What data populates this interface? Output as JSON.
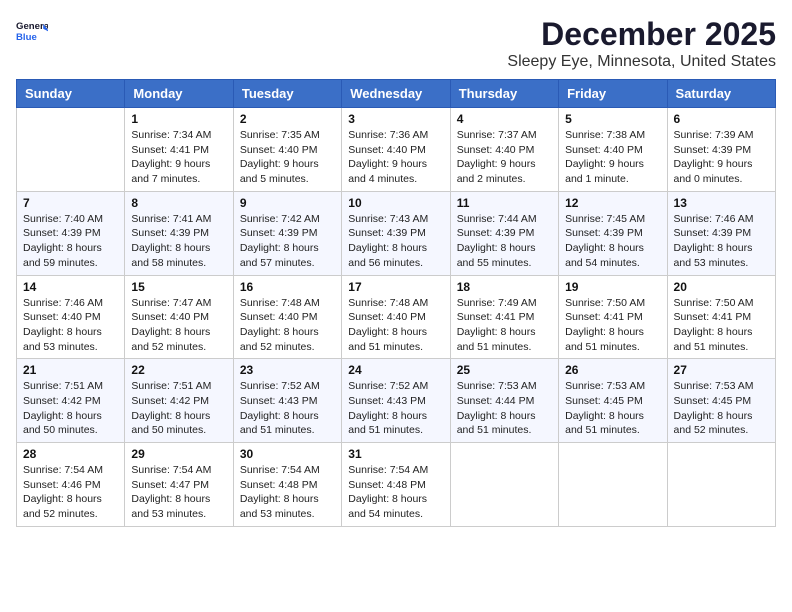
{
  "logo": {
    "general": "General",
    "blue": "Blue"
  },
  "header": {
    "title": "December 2025",
    "subtitle": "Sleepy Eye, Minnesota, United States"
  },
  "weekdays": [
    "Sunday",
    "Monday",
    "Tuesday",
    "Wednesday",
    "Thursday",
    "Friday",
    "Saturday"
  ],
  "weeks": [
    [
      {
        "day": "",
        "sunrise": "",
        "sunset": "",
        "daylight": ""
      },
      {
        "day": "1",
        "sunrise": "Sunrise: 7:34 AM",
        "sunset": "Sunset: 4:41 PM",
        "daylight": "Daylight: 9 hours and 7 minutes."
      },
      {
        "day": "2",
        "sunrise": "Sunrise: 7:35 AM",
        "sunset": "Sunset: 4:40 PM",
        "daylight": "Daylight: 9 hours and 5 minutes."
      },
      {
        "day": "3",
        "sunrise": "Sunrise: 7:36 AM",
        "sunset": "Sunset: 4:40 PM",
        "daylight": "Daylight: 9 hours and 4 minutes."
      },
      {
        "day": "4",
        "sunrise": "Sunrise: 7:37 AM",
        "sunset": "Sunset: 4:40 PM",
        "daylight": "Daylight: 9 hours and 2 minutes."
      },
      {
        "day": "5",
        "sunrise": "Sunrise: 7:38 AM",
        "sunset": "Sunset: 4:40 PM",
        "daylight": "Daylight: 9 hours and 1 minute."
      },
      {
        "day": "6",
        "sunrise": "Sunrise: 7:39 AM",
        "sunset": "Sunset: 4:39 PM",
        "daylight": "Daylight: 9 hours and 0 minutes."
      }
    ],
    [
      {
        "day": "7",
        "sunrise": "Sunrise: 7:40 AM",
        "sunset": "Sunset: 4:39 PM",
        "daylight": "Daylight: 8 hours and 59 minutes."
      },
      {
        "day": "8",
        "sunrise": "Sunrise: 7:41 AM",
        "sunset": "Sunset: 4:39 PM",
        "daylight": "Daylight: 8 hours and 58 minutes."
      },
      {
        "day": "9",
        "sunrise": "Sunrise: 7:42 AM",
        "sunset": "Sunset: 4:39 PM",
        "daylight": "Daylight: 8 hours and 57 minutes."
      },
      {
        "day": "10",
        "sunrise": "Sunrise: 7:43 AM",
        "sunset": "Sunset: 4:39 PM",
        "daylight": "Daylight: 8 hours and 56 minutes."
      },
      {
        "day": "11",
        "sunrise": "Sunrise: 7:44 AM",
        "sunset": "Sunset: 4:39 PM",
        "daylight": "Daylight: 8 hours and 55 minutes."
      },
      {
        "day": "12",
        "sunrise": "Sunrise: 7:45 AM",
        "sunset": "Sunset: 4:39 PM",
        "daylight": "Daylight: 8 hours and 54 minutes."
      },
      {
        "day": "13",
        "sunrise": "Sunrise: 7:46 AM",
        "sunset": "Sunset: 4:39 PM",
        "daylight": "Daylight: 8 hours and 53 minutes."
      }
    ],
    [
      {
        "day": "14",
        "sunrise": "Sunrise: 7:46 AM",
        "sunset": "Sunset: 4:40 PM",
        "daylight": "Daylight: 8 hours and 53 minutes."
      },
      {
        "day": "15",
        "sunrise": "Sunrise: 7:47 AM",
        "sunset": "Sunset: 4:40 PM",
        "daylight": "Daylight: 8 hours and 52 minutes."
      },
      {
        "day": "16",
        "sunrise": "Sunrise: 7:48 AM",
        "sunset": "Sunset: 4:40 PM",
        "daylight": "Daylight: 8 hours and 52 minutes."
      },
      {
        "day": "17",
        "sunrise": "Sunrise: 7:48 AM",
        "sunset": "Sunset: 4:40 PM",
        "daylight": "Daylight: 8 hours and 51 minutes."
      },
      {
        "day": "18",
        "sunrise": "Sunrise: 7:49 AM",
        "sunset": "Sunset: 4:41 PM",
        "daylight": "Daylight: 8 hours and 51 minutes."
      },
      {
        "day": "19",
        "sunrise": "Sunrise: 7:50 AM",
        "sunset": "Sunset: 4:41 PM",
        "daylight": "Daylight: 8 hours and 51 minutes."
      },
      {
        "day": "20",
        "sunrise": "Sunrise: 7:50 AM",
        "sunset": "Sunset: 4:41 PM",
        "daylight": "Daylight: 8 hours and 51 minutes."
      }
    ],
    [
      {
        "day": "21",
        "sunrise": "Sunrise: 7:51 AM",
        "sunset": "Sunset: 4:42 PM",
        "daylight": "Daylight: 8 hours and 50 minutes."
      },
      {
        "day": "22",
        "sunrise": "Sunrise: 7:51 AM",
        "sunset": "Sunset: 4:42 PM",
        "daylight": "Daylight: 8 hours and 50 minutes."
      },
      {
        "day": "23",
        "sunrise": "Sunrise: 7:52 AM",
        "sunset": "Sunset: 4:43 PM",
        "daylight": "Daylight: 8 hours and 51 minutes."
      },
      {
        "day": "24",
        "sunrise": "Sunrise: 7:52 AM",
        "sunset": "Sunset: 4:43 PM",
        "daylight": "Daylight: 8 hours and 51 minutes."
      },
      {
        "day": "25",
        "sunrise": "Sunrise: 7:53 AM",
        "sunset": "Sunset: 4:44 PM",
        "daylight": "Daylight: 8 hours and 51 minutes."
      },
      {
        "day": "26",
        "sunrise": "Sunrise: 7:53 AM",
        "sunset": "Sunset: 4:45 PM",
        "daylight": "Daylight: 8 hours and 51 minutes."
      },
      {
        "day": "27",
        "sunrise": "Sunrise: 7:53 AM",
        "sunset": "Sunset: 4:45 PM",
        "daylight": "Daylight: 8 hours and 52 minutes."
      }
    ],
    [
      {
        "day": "28",
        "sunrise": "Sunrise: 7:54 AM",
        "sunset": "Sunset: 4:46 PM",
        "daylight": "Daylight: 8 hours and 52 minutes."
      },
      {
        "day": "29",
        "sunrise": "Sunrise: 7:54 AM",
        "sunset": "Sunset: 4:47 PM",
        "daylight": "Daylight: 8 hours and 53 minutes."
      },
      {
        "day": "30",
        "sunrise": "Sunrise: 7:54 AM",
        "sunset": "Sunset: 4:48 PM",
        "daylight": "Daylight: 8 hours and 53 minutes."
      },
      {
        "day": "31",
        "sunrise": "Sunrise: 7:54 AM",
        "sunset": "Sunset: 4:48 PM",
        "daylight": "Daylight: 8 hours and 54 minutes."
      },
      {
        "day": "",
        "sunrise": "",
        "sunset": "",
        "daylight": ""
      },
      {
        "day": "",
        "sunrise": "",
        "sunset": "",
        "daylight": ""
      },
      {
        "day": "",
        "sunrise": "",
        "sunset": "",
        "daylight": ""
      }
    ]
  ]
}
